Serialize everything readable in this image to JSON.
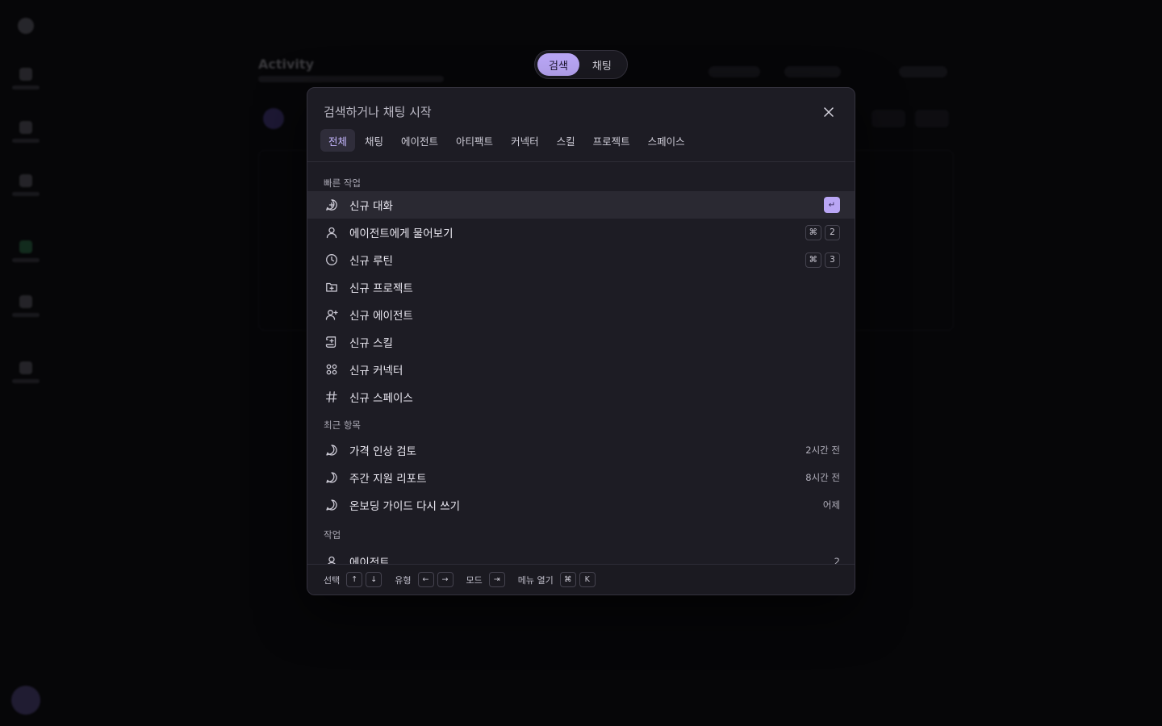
{
  "background": {
    "page_title": "Activity",
    "avatar_color": "#7d6bc7",
    "accent_green": "#3fae6a"
  },
  "mode_toggle": {
    "search_label": "검색",
    "chat_label": "채팅",
    "active": "search",
    "active_color": "#b9a6f5"
  },
  "palette": {
    "search": {
      "placeholder": "검색하거나 채팅 시작",
      "value": ""
    },
    "close_icon": "close-icon",
    "tabs": [
      {
        "label": "전체",
        "active": true
      },
      {
        "label": "채팅",
        "active": false
      },
      {
        "label": "에이전트",
        "active": false
      },
      {
        "label": "아티팩트",
        "active": false
      },
      {
        "label": "커넥터",
        "active": false
      },
      {
        "label": "스킬",
        "active": false
      },
      {
        "label": "프로젝트",
        "active": false
      },
      {
        "label": "스페이스",
        "active": false
      }
    ],
    "quick_actions": {
      "label": "빠른 작업",
      "items": [
        {
          "label": "신규 대화",
          "icon": "new-chat-icon",
          "shortcut": [
            "↵"
          ],
          "selected": true
        },
        {
          "label": "에이전트에게 물어보기",
          "icon": "user-icon",
          "shortcut": [
            "⌘",
            "2"
          ]
        },
        {
          "label": "신규 루틴",
          "icon": "clock-icon",
          "shortcut": [
            "⌘",
            "3"
          ]
        },
        {
          "label": "신규 프로젝트",
          "icon": "folder-plus-icon",
          "shortcut": []
        },
        {
          "label": "신규 에이전트",
          "icon": "user-plus-icon",
          "shortcut": []
        },
        {
          "label": "신규 스킬",
          "icon": "scroll-icon",
          "shortcut": []
        },
        {
          "label": "신규 커넥터",
          "icon": "grid-icon",
          "shortcut": []
        },
        {
          "label": "신규 스페이스",
          "icon": "hash-icon",
          "shortcut": []
        }
      ]
    },
    "recent": {
      "label": "최근 항목",
      "items": [
        {
          "label": "가격 인상 검토",
          "icon": "chat-bubble-icon",
          "time": "2시간 전"
        },
        {
          "label": "주간 지원 리포트",
          "icon": "chat-bubble-icon",
          "time": "8시간 전"
        },
        {
          "label": "온보딩 가이드 다시 쓰기",
          "icon": "chat-bubble-icon",
          "time": "어제"
        }
      ]
    },
    "work": {
      "label": "작업",
      "items": [
        {
          "label": "에이전트",
          "icon": "user-icon",
          "count": "2"
        }
      ]
    },
    "footer": {
      "select": {
        "label": "선택",
        "keys": [
          "↑",
          "↓"
        ]
      },
      "type": {
        "label": "유형",
        "keys": [
          "←",
          "→"
        ]
      },
      "mode": {
        "label": "모드",
        "keys": [
          "⇥"
        ]
      },
      "menu": {
        "label": "메뉴 열기",
        "keys": [
          "⌘",
          "K"
        ]
      }
    }
  }
}
